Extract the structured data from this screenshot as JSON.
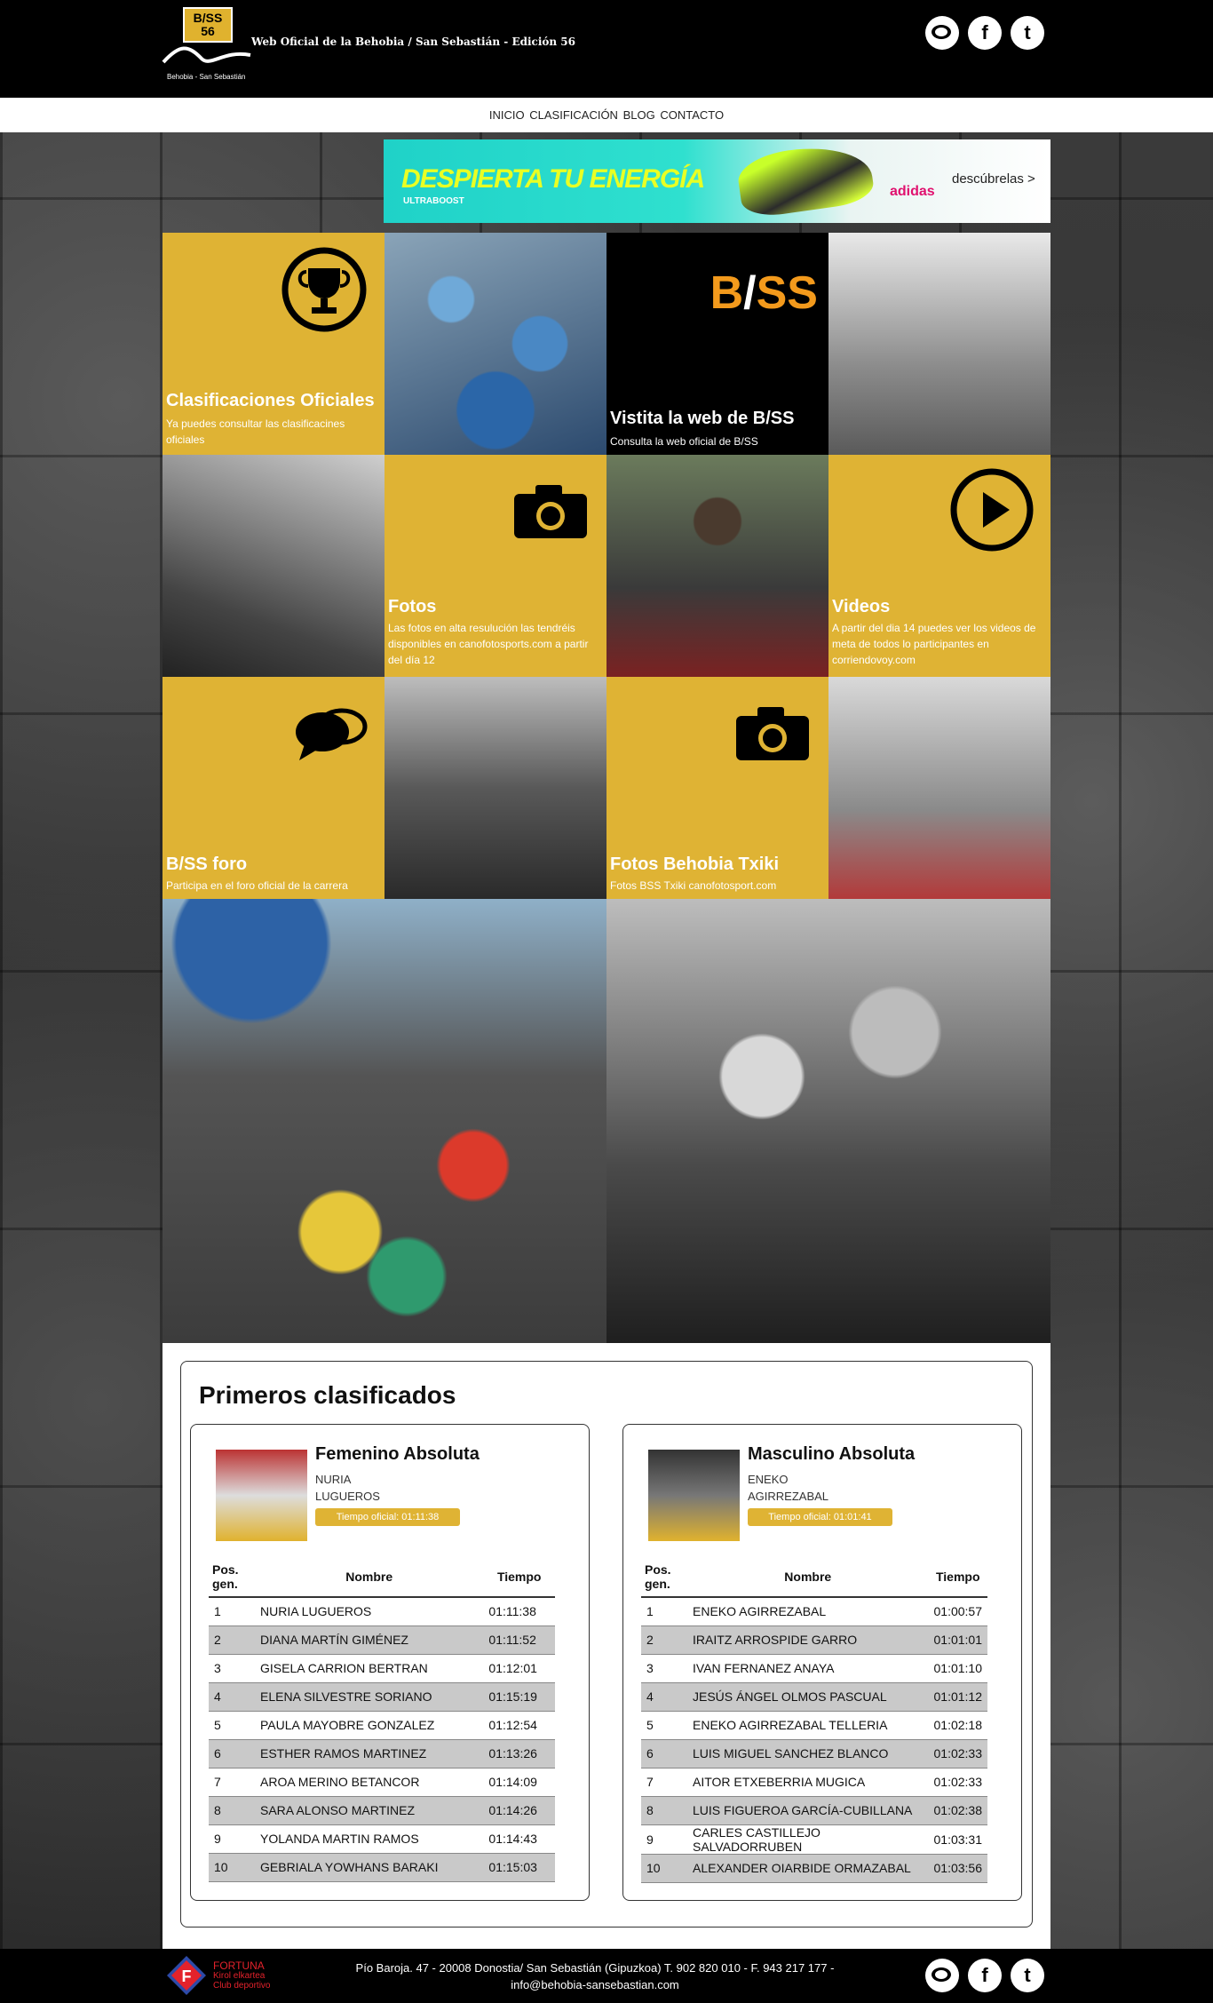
{
  "header": {
    "logo_line1": "B/SS",
    "logo_line2": "56",
    "logo_sub": "Behobia - San Sebastián",
    "site_title": "Web Oficial de la Behobia / San Sebastián - Edición 56",
    "social": [
      "chat-icon",
      "facebook-icon",
      "twitter-icon"
    ]
  },
  "nav": {
    "items": [
      "INICIO",
      "CLASIFICACIÓN",
      "BLOG",
      "CONTACTO"
    ]
  },
  "banner": {
    "headline": "DESPIERTA TU ENERGÍA",
    "sub": "ULTRABOOST",
    "brand": "adidas",
    "cta": "descúbrelas >"
  },
  "tiles": {
    "clasificaciones": {
      "title": "Clasificaciones Oficiales",
      "desc": "Ya puedes consultar las clasificacines oficiales"
    },
    "bss_web": {
      "logo": "B/SS",
      "title": "Vistita la web de B/SS",
      "desc": "Consulta la web oficial de B/SS"
    },
    "fotos": {
      "title": "Fotos",
      "desc": "Las fotos en alta resulución las tendréis disponibles en canofotosports.com a partir del día 12"
    },
    "videos": {
      "title": "Videos",
      "desc": "A partir del dia 14 puedes ver los videos de meta de todos lo participantes en corriendovoy.com"
    },
    "foro": {
      "title": "B/SS foro",
      "desc": "Participa en el foro oficial de la carrera"
    },
    "txiki": {
      "title": "Fotos Behobia Txiki",
      "desc": "Fotos BSS Txiki canofotosport.com"
    }
  },
  "results": {
    "title": "Primeros clasificados",
    "headers": {
      "pos": "Pos. gen.",
      "name": "Nombre",
      "time": "Tiempo"
    },
    "female": {
      "title": "Femenino Absoluta",
      "first_name": "NURIA",
      "last_name": "LUGUEROS",
      "badge": "Tiempo oficial: 01:11:38",
      "rows": [
        [
          "1",
          "NURIA LUGUEROS",
          "01:11:38"
        ],
        [
          "2",
          "DIANA MARTÍN GIMÉNEZ",
          "01:11:52"
        ],
        [
          "3",
          "GISELA CARRION BERTRAN",
          "01:12:01"
        ],
        [
          "4",
          "ELENA SILVESTRE SORIANO",
          "01:15:19"
        ],
        [
          "5",
          "PAULA MAYOBRE GONZALEZ",
          "01:12:54"
        ],
        [
          "6",
          "ESTHER RAMOS MARTINEZ",
          "01:13:26"
        ],
        [
          "7",
          "AROA MERINO BETANCOR",
          "01:14:09"
        ],
        [
          "8",
          "SARA ALONSO MARTINEZ",
          "01:14:26"
        ],
        [
          "9",
          "YOLANDA MARTIN RAMOS",
          "01:14:43"
        ],
        [
          "10",
          "GEBRIALA YOWHANS BARAKI",
          "01:15:03"
        ]
      ]
    },
    "male": {
      "title": "Masculino Absoluta",
      "first_name": "ENEKO",
      "last_name": "AGIRREZABAL",
      "badge": "Tiempo oficial: 01:01:41",
      "rows": [
        [
          "1",
          "ENEKO AGIRREZABAL",
          "01:00:57"
        ],
        [
          "2",
          "IRAITZ ARROSPIDE GARRO",
          "01:01:01"
        ],
        [
          "3",
          "IVAN FERNANEZ ANAYA",
          "01:01:10"
        ],
        [
          "4",
          "JESÚS ÁNGEL OLMOS PASCUAL",
          "01:01:12"
        ],
        [
          "5",
          "ENEKO AGIRREZABAL TELLERIA",
          "01:02:18"
        ],
        [
          "6",
          "LUIS MIGUEL SANCHEZ BLANCO",
          "01:02:33"
        ],
        [
          "7",
          "AITOR ETXEBERRIA MUGICA",
          "01:02:33"
        ],
        [
          "8",
          "LUIS FIGUEROA GARCÍA-CUBILLANA",
          "01:02:38"
        ],
        [
          "9",
          "CARLES CASTILLEJO SALVADORRUBEN",
          "01:03:31"
        ],
        [
          "10",
          "ALEXANDER OIARBIDE ORMAZABAL",
          "01:03:56"
        ]
      ]
    }
  },
  "footer": {
    "sponsor_line1": "FORTUNA",
    "sponsor_line2": "Kirol elkartea",
    "sponsor_line3": "Club deportivo",
    "address": "Pío Baroja. 47 - 20008 Donostia/ San Sebastián (Gipuzkoa) T. 902 820 010 - F. 943 217 177 -",
    "email": "info@behobia-sansebastian.com"
  },
  "colors": {
    "accent": "#dfb334",
    "black": "#000000"
  }
}
